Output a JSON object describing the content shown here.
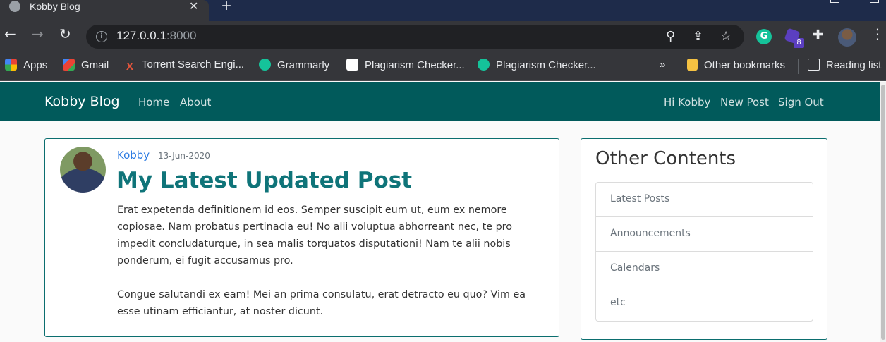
{
  "browser": {
    "tab_title": "Kobby Blog",
    "tab_close": "✕",
    "new_tab": "+",
    "url_host": "127.0.0.1",
    "url_port": ":8000",
    "extension_badge": "8",
    "bookmarks": [
      {
        "label": "Apps",
        "icon": "apps-grid-icon",
        "color": "#ea4335"
      },
      {
        "label": "Gmail",
        "icon": "gmail-icon",
        "color": "#ea4335"
      },
      {
        "label": "Torrent Search Engi...",
        "icon": "torrent-x-icon",
        "color": "#e8553b"
      },
      {
        "label": "Grammarly",
        "icon": "grammarly-icon",
        "color": "#15c39a"
      },
      {
        "label": "Plagiarism Checker...",
        "icon": "sst-icon",
        "color": "#ffffff"
      },
      {
        "label": "Plagiarism Checker...",
        "icon": "grammarly-icon",
        "color": "#15c39a"
      },
      {
        "label": "Other bookmarks",
        "icon": "folder-icon",
        "color": "#f5c242"
      },
      {
        "label": "Reading list",
        "icon": "reading-list-icon",
        "color": "#e8eaed"
      }
    ],
    "more_chevron": "»"
  },
  "site": {
    "brand": "Kobby Blog",
    "nav_left": [
      "Home",
      "About"
    ],
    "nav_right": [
      "Hi Kobby",
      "New Post",
      "Sign Out"
    ],
    "nav_color": "#015a5b"
  },
  "post": {
    "author": "Kobby",
    "date": "13-Jun-2020",
    "title": "My Latest Updated Post",
    "paragraphs": [
      "Erat expetenda definitionem id eos. Semper suscipit eum ut, eum ex nemore copiosae. Nam probatus pertinacia eu! No alii voluptua abhorreant nec, te pro impedit concludaturque, in sea malis torquatos disputationi! Nam te alii nobis ponderum, ei fugit accusamus pro.",
      "Congue salutandi ex eam! Mei an prima consulatu, erat detracto eu quo? Vim ea esse utinam efficiantur, at noster dicunt."
    ]
  },
  "sidebar": {
    "heading": "Other Contents",
    "items": [
      "Latest Posts",
      "Announcements",
      "Calendars",
      "etc"
    ]
  }
}
